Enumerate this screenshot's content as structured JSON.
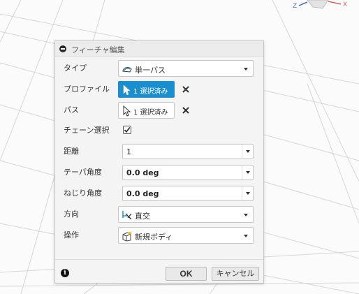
{
  "dialog": {
    "title": "フィーチャ編集",
    "rows": {
      "type": {
        "label": "タイプ",
        "value": "単一パス",
        "icon": "single-path-icon"
      },
      "profile": {
        "label": "プロファイル",
        "value": "1 選択済み",
        "icon": "select-arrow-icon",
        "state": "active"
      },
      "path": {
        "label": "パス",
        "value": "1 選択済み",
        "icon": "select-arrow-icon"
      },
      "chain": {
        "label": "チェーン選択",
        "checked": true
      },
      "distance": {
        "label": "距離",
        "value": "1"
      },
      "taper": {
        "label": "テーパ角度",
        "value": "0.0 deg"
      },
      "twist": {
        "label": "ねじり角度",
        "value": "0.0 deg"
      },
      "orientation": {
        "label": "方向",
        "value": "直交",
        "icon": "perpendicular-icon"
      },
      "operation": {
        "label": "操作",
        "value": "新規ボディ",
        "icon": "new-body-icon"
      }
    },
    "buttons": {
      "ok": "OK",
      "cancel": "キャンセル"
    }
  },
  "viewcube": {
    "z_label": "Z",
    "x_label": "X"
  },
  "colors": {
    "accent": "#1b8ed0",
    "dialog_bg": "#f4f4f4",
    "viewport_bg": "#fbfbfb",
    "grid": "#d6d6d6",
    "axis_x": "#e06060",
    "axis_z": "#4a6fd0"
  }
}
